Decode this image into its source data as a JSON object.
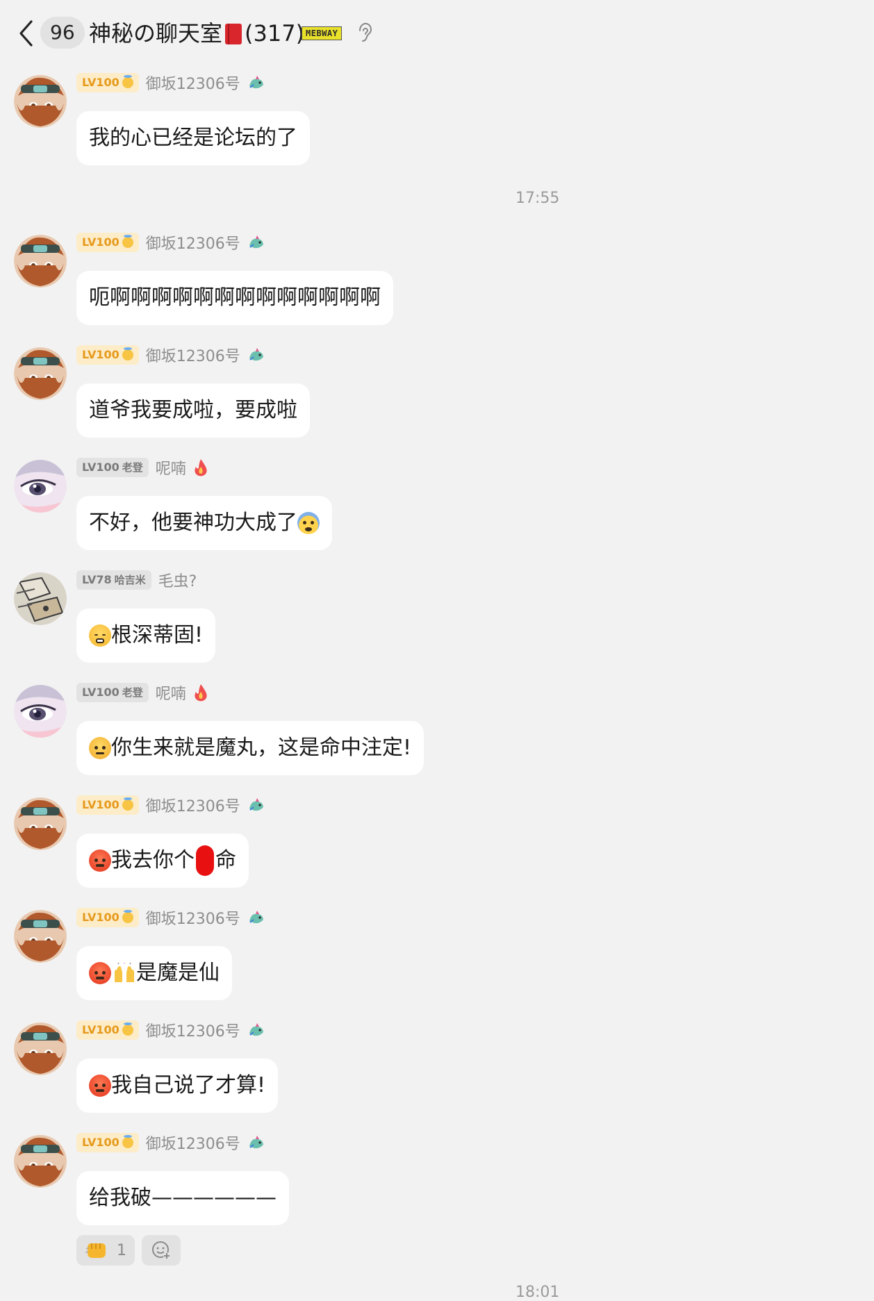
{
  "header": {
    "unread_count": "96",
    "title": "神秘の聊天室",
    "member_count": "(317)",
    "group_tag": "MEBWAY"
  },
  "levels": {
    "misaka": "LV100",
    "nina": "LV100",
    "nina_title": "老登",
    "hajimi": "LV78",
    "hajimi_title": "哈吉米"
  },
  "names": {
    "misaka": "御坂12306号",
    "nina": "呢喃",
    "hajimi": "毛虫?"
  },
  "timestamps": [
    "17:55",
    "18:01"
  ],
  "messages": [
    {
      "sender": "misaka",
      "text": "我的心已经是论坛的了"
    },
    {
      "sender": "misaka",
      "text": "呃啊啊啊啊啊啊啊啊啊啊啊啊啊"
    },
    {
      "sender": "misaka",
      "text": "道爷我要成啦，要成啦"
    },
    {
      "sender": "nina",
      "text": "不好，他要神功大成了",
      "emoji": "fearful-emoji"
    },
    {
      "sender": "hajimi",
      "text": "根深蒂固!",
      "emoji": "triumph-emoji"
    },
    {
      "sender": "nina",
      "text": "你生来就是魔丸，这是命中注定!",
      "emoji": "annoyed-emoji"
    },
    {
      "sender": "misaka",
      "text_before": "我去你个",
      "text_after": "命",
      "emoji": "angry-emoji"
    },
    {
      "sender": "misaka",
      "text": "是魔是仙",
      "emoji": "angry-emoji raised-hands-emoji"
    },
    {
      "sender": "misaka",
      "text": "我自己说了才算!",
      "emoji": "angry-emoji"
    },
    {
      "sender": "misaka",
      "text": "给我破——————"
    }
  ],
  "reactions": [
    {
      "icon": "fist-bump-icon",
      "count": "1"
    },
    {
      "icon": "add-reaction-icon"
    }
  ],
  "colors": {
    "background": "#f2f2f2",
    "bubble": "#ffffff",
    "level_gold_bg": "#fdecc8",
    "level_gold_text": "#e69a1c",
    "level_gray_bg": "#e3e3e3",
    "censor": "#e81010"
  }
}
